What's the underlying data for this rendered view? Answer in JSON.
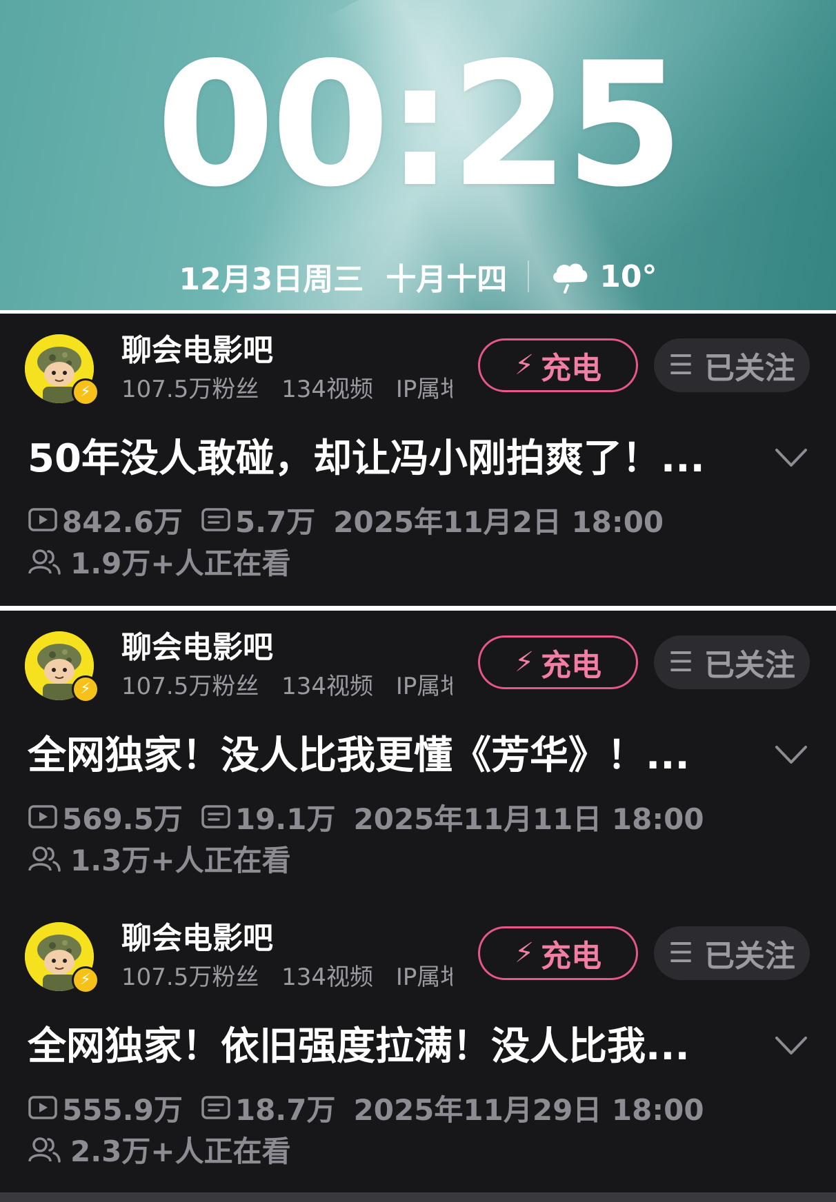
{
  "lockscreen": {
    "time": "00:25",
    "date": "12月3日周三",
    "lunar_date": "十月十四",
    "weather_icon": "cloud-rain-icon",
    "temperature": "10°"
  },
  "cards": [
    {
      "channel_name": "聊会电影吧",
      "followers": "107.5万粉丝",
      "videos": "134视频",
      "ip": "IP属地",
      "charge_label": "充电",
      "follow_label": "已关注",
      "title": "50年没人敢碰，却让冯小刚拍爽了！...",
      "plays": "842.6万",
      "danmaku": "5.7万",
      "published": "2025年11月2日 18:00",
      "watching": "1.9万+人正在看"
    },
    {
      "channel_name": "聊会电影吧",
      "followers": "107.5万粉丝",
      "videos": "134视频",
      "ip": "IP属地",
      "charge_label": "充电",
      "follow_label": "已关注",
      "title": "全网独家！没人比我更懂《芳华》！...",
      "plays": "569.5万",
      "danmaku": "19.1万",
      "published": "2025年11月11日 18:00",
      "watching": "1.3万+人正在看"
    },
    {
      "channel_name": "聊会电影吧",
      "followers": "107.5万粉丝",
      "videos": "134视频",
      "ip": "IP属地",
      "charge_label": "充电",
      "follow_label": "已关注",
      "title": "全网独家！依旧强度拉满！没人比我...",
      "plays": "555.9万",
      "danmaku": "18.7万",
      "published": "2025年11月29日 18:00",
      "watching": "2.3万+人正在看"
    }
  ],
  "colors": {
    "card_background": "#17171a",
    "charge_accent": "#e8578a",
    "muted_text": "#8c8c92",
    "lockscreen_teal": "#6fb5b2"
  }
}
